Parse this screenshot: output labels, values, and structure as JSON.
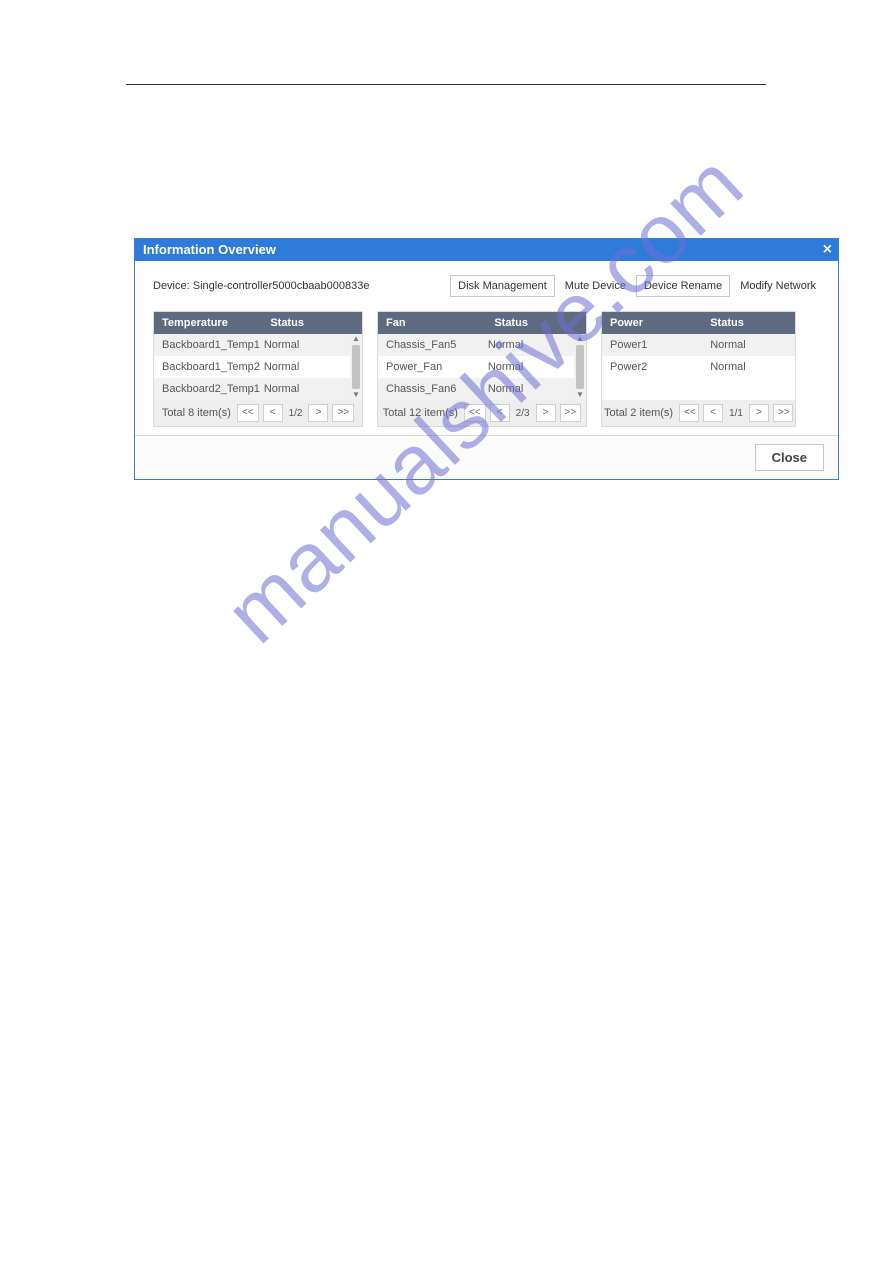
{
  "watermark": "manualshive.com",
  "dialog": {
    "title": "Information Overview",
    "close_icon": "×",
    "device_text": "Device: Single-controller5000cbaab000833e",
    "actions": {
      "disk": "Disk Management",
      "mute": "Mute Device",
      "rename": "Device Rename",
      "modify": "Modify Network"
    },
    "panels": [
      {
        "id": "temperature",
        "header": {
          "col1": "Temperature",
          "col2": "Status"
        },
        "rows": [
          {
            "name": "Backboard1_Temp1",
            "status": "Normal"
          },
          {
            "name": "Backboard1_Temp2",
            "status": "Normal"
          },
          {
            "name": "Backboard2_Temp1",
            "status": "Normal"
          }
        ],
        "footer": {
          "total": "Total 8 item(s)",
          "page": "1/2"
        },
        "scrollable": true
      },
      {
        "id": "fan",
        "header": {
          "col1": "Fan",
          "col2": "Status"
        },
        "rows": [
          {
            "name": "Chassis_Fan5",
            "status": "Normal"
          },
          {
            "name": "Power_Fan",
            "status": "Normal"
          },
          {
            "name": "Chassis_Fan6",
            "status": "Normal"
          }
        ],
        "footer": {
          "total": "Total 12 item(s)",
          "page": "2/3"
        },
        "scrollable": true
      },
      {
        "id": "power",
        "header": {
          "col1": "Power",
          "col2": "Status"
        },
        "rows": [
          {
            "name": "Power1",
            "status": "Normal"
          },
          {
            "name": "Power2",
            "status": "Normal"
          }
        ],
        "footer": {
          "total": "Total 2 item(s)",
          "page": "1/1"
        },
        "scrollable": false
      }
    ],
    "pager": {
      "first": "<<",
      "prev": "<",
      "next": ">",
      "last": ">>"
    },
    "footer": {
      "close": "Close"
    }
  }
}
